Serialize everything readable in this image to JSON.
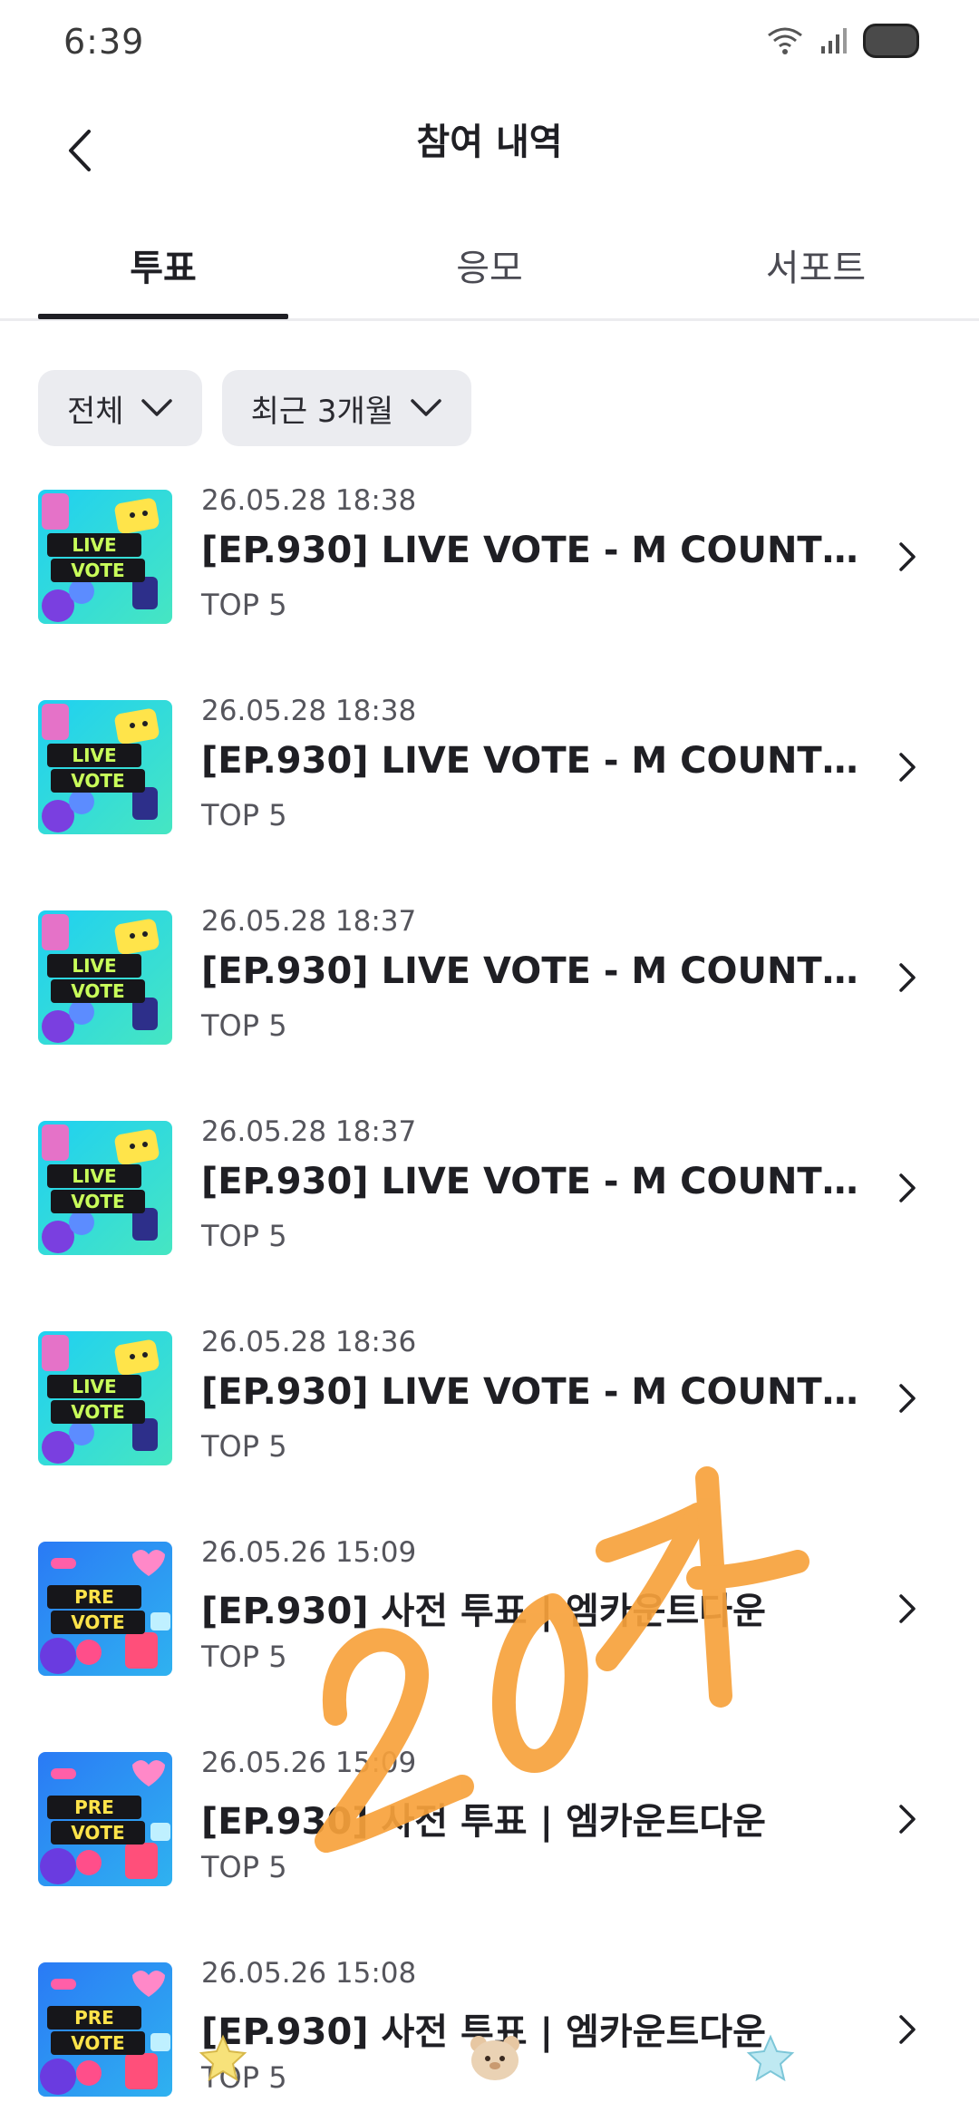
{
  "status": {
    "time": "6:39"
  },
  "header": {
    "title": "참여 내역"
  },
  "tabs": [
    {
      "label": "투표",
      "active": true
    },
    {
      "label": "응모",
      "active": false
    },
    {
      "label": "서포트",
      "active": false
    }
  ],
  "filters": [
    {
      "label": "전체"
    },
    {
      "label": "최근 3개월"
    }
  ],
  "items": [
    {
      "date": "26.05.28 18:38",
      "title": "[EP.930] LIVE VOTE - M COUNTDO...",
      "sub": "TOP 5",
      "thumb": "live-vote"
    },
    {
      "date": "26.05.28 18:38",
      "title": "[EP.930] LIVE VOTE - M COUNTDO...",
      "sub": "TOP 5",
      "thumb": "live-vote"
    },
    {
      "date": "26.05.28 18:37",
      "title": "[EP.930] LIVE VOTE - M COUNTDO...",
      "sub": "TOP 5",
      "thumb": "live-vote"
    },
    {
      "date": "26.05.28 18:37",
      "title": "[EP.930] LIVE VOTE - M COUNTDO...",
      "sub": "TOP 5",
      "thumb": "live-vote"
    },
    {
      "date": "26.05.28 18:36",
      "title": "[EP.930] LIVE VOTE - M COUNTDO...",
      "sub": "TOP 5",
      "thumb": "live-vote"
    },
    {
      "date": "26.05.26 15:09",
      "title": "[EP.930] 사전 투표 | 엠카운트다운",
      "sub": "TOP 5",
      "thumb": "pre-vote"
    },
    {
      "date": "26.05.26 15:09",
      "title": "[EP.930] 사전 투표 | 엠카운트다운",
      "sub": "TOP 5",
      "thumb": "pre-vote"
    },
    {
      "date": "26.05.26 15:08",
      "title": "[EP.930] 사전 투표 | 엠카운트다운",
      "sub": "TOP 5",
      "thumb": "pre-vote"
    }
  ],
  "thumbnails": {
    "live": {
      "line1": "LIVE",
      "line2": "VOTE"
    },
    "pre": {
      "line1": "PRE",
      "line2": "VOTE"
    }
  },
  "annotation": {
    "handwritten": "20개"
  },
  "colors": {
    "accent_text": "#1f1f24",
    "chip_bg": "#ebecf0",
    "scribble": "#f7a23c",
    "live_bg": "#2fd3e6",
    "pre_bg": "#2f6df0"
  }
}
